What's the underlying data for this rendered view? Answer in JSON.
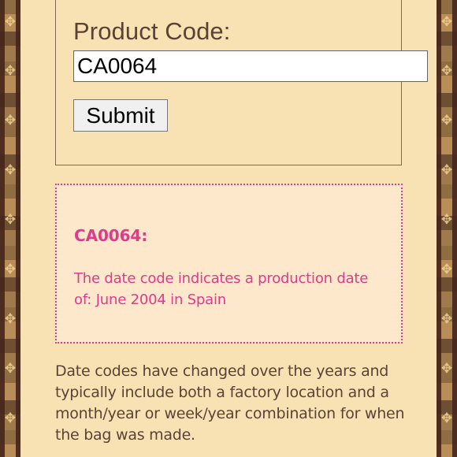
{
  "colors": {
    "page_background": "#f8e2b4",
    "text_brown": "#5a4335",
    "result_pink": "#e13a8d",
    "result_background": "#fde8cc",
    "pattern_brown": "#8f6d43",
    "pattern_dark_brown": "#46261c"
  },
  "icons": {
    "left_border": "decorative-monogram-pattern",
    "right_border": "decorative-monogram-pattern"
  },
  "form": {
    "product_code_label": "Product Code:",
    "product_code_value": "CA0064",
    "submit_label": "Submit"
  },
  "result": {
    "code": "CA0064:",
    "message": "The date code indicates a production date of: June 2004 in Spain"
  },
  "info": {
    "description": "Date codes have changed over the years and typically include both a factory location and a month/year or week/year combination for when the bag was made."
  }
}
